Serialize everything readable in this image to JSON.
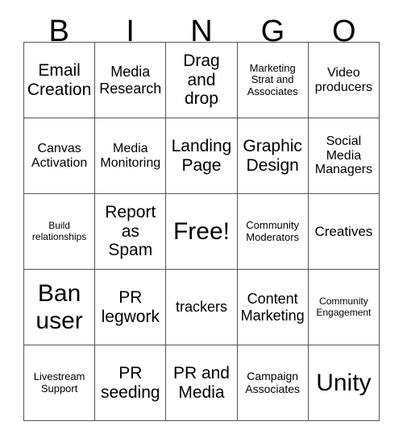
{
  "header": {
    "letters": [
      "B",
      "I",
      "N",
      "G",
      "O"
    ]
  },
  "grid": {
    "rows": 5,
    "columns": 5,
    "border_color": "#555555",
    "background_color": "#ffffff",
    "text_color": "#000000",
    "cells": [
      [
        {
          "text": "Email Creation",
          "font_size": "21px"
        },
        {
          "text": "Media Research",
          "font_size": "18px"
        },
        {
          "text": "Drag and drop",
          "font_size": "21px"
        },
        {
          "text": "Marketing Strat and Associates",
          "font_size": "13px"
        },
        {
          "text": "Video producers",
          "font_size": "16px"
        }
      ],
      [
        {
          "text": "Canvas Activation",
          "font_size": "16px"
        },
        {
          "text": "Media Monitoring",
          "font_size": "16px"
        },
        {
          "text": "Landing Page",
          "font_size": "21px"
        },
        {
          "text": "Graphic Design",
          "font_size": "21px"
        },
        {
          "text": "Social Media Managers",
          "font_size": "16px"
        }
      ],
      [
        {
          "text": "Build relationships",
          "font_size": "12px"
        },
        {
          "text": "Report as Spam",
          "font_size": "21px"
        },
        {
          "text": "Free!",
          "font_size": "30px"
        },
        {
          "text": "Community Moderators",
          "font_size": "13px"
        },
        {
          "text": "Creatives",
          "font_size": "17px"
        }
      ],
      [
        {
          "text": "Ban user",
          "font_size": "30px"
        },
        {
          "text": "PR legwork",
          "font_size": "21px"
        },
        {
          "text": "trackers",
          "font_size": "18px"
        },
        {
          "text": "Content Marketing",
          "font_size": "18px"
        },
        {
          "text": "Community Engagement",
          "font_size": "12px"
        }
      ],
      [
        {
          "text": "Livestream Support",
          "font_size": "13px"
        },
        {
          "text": "PR seeding",
          "font_size": "21px"
        },
        {
          "text": "PR and Media",
          "font_size": "21px"
        },
        {
          "text": "Campaign Associates",
          "font_size": "14px"
        },
        {
          "text": "Unity",
          "font_size": "30px"
        }
      ]
    ]
  }
}
